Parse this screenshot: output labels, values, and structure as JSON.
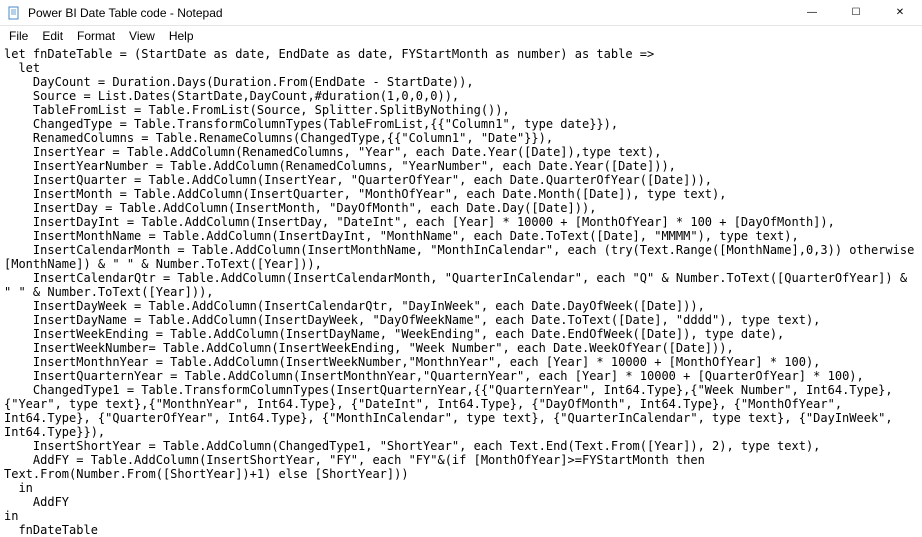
{
  "window": {
    "title": "Power BI Date Table code - Notepad"
  },
  "menu": {
    "file": "File",
    "edit": "Edit",
    "format": "Format",
    "view": "View",
    "help": "Help"
  },
  "buttons": {
    "minimize": "—",
    "maximize": "☐",
    "close": "✕"
  },
  "editor": {
    "content": "let fnDateTable = (StartDate as date, EndDate as date, FYStartMonth as number) as table =>\n  let\n    DayCount = Duration.Days(Duration.From(EndDate - StartDate)),\n    Source = List.Dates(StartDate,DayCount,#duration(1,0,0,0)),\n    TableFromList = Table.FromList(Source, Splitter.SplitByNothing()),\n    ChangedType = Table.TransformColumnTypes(TableFromList,{{\"Column1\", type date}}),\n    RenamedColumns = Table.RenameColumns(ChangedType,{{\"Column1\", \"Date\"}}),\n    InsertYear = Table.AddColumn(RenamedColumns, \"Year\", each Date.Year([Date]),type text),\n    InsertYearNumber = Table.AddColumn(RenamedColumns, \"YearNumber\", each Date.Year([Date])),\n    InsertQuarter = Table.AddColumn(InsertYear, \"QuarterOfYear\", each Date.QuarterOfYear([Date])),\n    InsertMonth = Table.AddColumn(InsertQuarter, \"MonthOfYear\", each Date.Month([Date]), type text),\n    InsertDay = Table.AddColumn(InsertMonth, \"DayOfMonth\", each Date.Day([Date])),\n    InsertDayInt = Table.AddColumn(InsertDay, \"DateInt\", each [Year] * 10000 + [MonthOfYear] * 100 + [DayOfMonth]),\n    InsertMonthName = Table.AddColumn(InsertDayInt, \"MonthName\", each Date.ToText([Date], \"MMMM\"), type text),\n    InsertCalendarMonth = Table.AddColumn(InsertMonthName, \"MonthInCalendar\", each (try(Text.Range([MonthName],0,3)) otherwise [MonthName]) & \" \" & Number.ToText([Year])),\n    InsertCalendarQtr = Table.AddColumn(InsertCalendarMonth, \"QuarterInCalendar\", each \"Q\" & Number.ToText([QuarterOfYear]) & \" \" & Number.ToText([Year])),\n    InsertDayWeek = Table.AddColumn(InsertCalendarQtr, \"DayInWeek\", each Date.DayOfWeek([Date])),\n    InsertDayName = Table.AddColumn(InsertDayWeek, \"DayOfWeekName\", each Date.ToText([Date], \"dddd\"), type text),\n    InsertWeekEnding = Table.AddColumn(InsertDayName, \"WeekEnding\", each Date.EndOfWeek([Date]), type date),\n    InsertWeekNumber= Table.AddColumn(InsertWeekEnding, \"Week Number\", each Date.WeekOfYear([Date])),\n    InsertMonthnYear = Table.AddColumn(InsertWeekNumber,\"MonthnYear\", each [Year] * 10000 + [MonthOfYear] * 100),\n    InsertQuarternYear = Table.AddColumn(InsertMonthnYear,\"QuarternYear\", each [Year] * 10000 + [QuarterOfYear] * 100),\n    ChangedType1 = Table.TransformColumnTypes(InsertQuarternYear,{{\"QuarternYear\", Int64.Type},{\"Week Number\", Int64.Type},{\"Year\", type text},{\"MonthnYear\", Int64.Type}, {\"DateInt\", Int64.Type}, {\"DayOfMonth\", Int64.Type}, {\"MonthOfYear\", Int64.Type}, {\"QuarterOfYear\", Int64.Type}, {\"MonthInCalendar\", type text}, {\"QuarterInCalendar\", type text}, {\"DayInWeek\", Int64.Type}}),\n    InsertShortYear = Table.AddColumn(ChangedType1, \"ShortYear\", each Text.End(Text.From([Year]), 2), type text),\n    AddFY = Table.AddColumn(InsertShortYear, \"FY\", each \"FY\"&(if [MonthOfYear]>=FYStartMonth then Text.From(Number.From([ShortYear])+1) else [ShortYear]))\n  in\n    AddFY\nin\n  fnDateTable\n"
  }
}
